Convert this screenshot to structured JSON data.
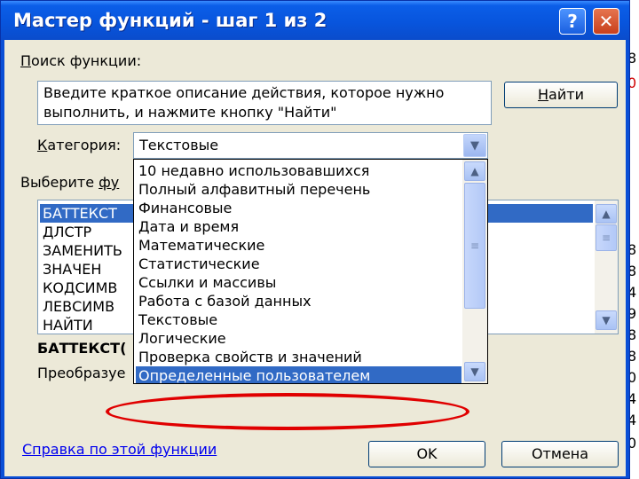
{
  "sheet_fragments": [
    "8",
    "0",
    "8",
    "8",
    "4",
    "9",
    "8",
    "8",
    "0",
    "4",
    "4",
    "0"
  ],
  "dialog": {
    "title": "Мастер функций - шаг 1 из 2",
    "help_glyph": "?",
    "close_glyph": "✕"
  },
  "search": {
    "label_accel": "П",
    "label_rest": "оиск функции:",
    "value": "Введите краткое описание действия, которое нужно выполнить, и нажмите кнопку \"Найти\"",
    "find_accel": "Н",
    "find_rest": "айти"
  },
  "category": {
    "label_accel": "К",
    "label_rest": "атегория:",
    "selected": "Текстовые",
    "options": [
      "10 недавно использовавшихся",
      "Полный алфавитный перечень",
      "Финансовые",
      "Дата и время",
      "Математические",
      "Статистические",
      "Ссылки и массивы",
      "Работа с базой данных",
      "Текстовые",
      "Логические",
      "Проверка свойств и значений",
      "Определенные пользователем"
    ],
    "highlighted": "Определенные пользователем"
  },
  "functions": {
    "label_start": "Выберите ",
    "label_accel": "фу",
    "items": [
      "БАТТЕКСТ",
      "ДЛСТР",
      "ЗАМЕНИТЬ",
      "ЗНАЧЕН",
      "КОДСИМВ",
      "ЛЕВСИМВ",
      "НАЙТИ"
    ],
    "selected": "БАТТЕКСТ",
    "syntax": "БАТТЕКСТ(",
    "description": "Преобразуе"
  },
  "footer": {
    "help_link": "Справка по этой функции",
    "ok": "OK",
    "cancel": "Отмена"
  },
  "colors": {
    "title_bar": "#0855dd",
    "dialog_face": "#ece9d8",
    "selection": "#316ac5",
    "annotation": "#e00000"
  }
}
